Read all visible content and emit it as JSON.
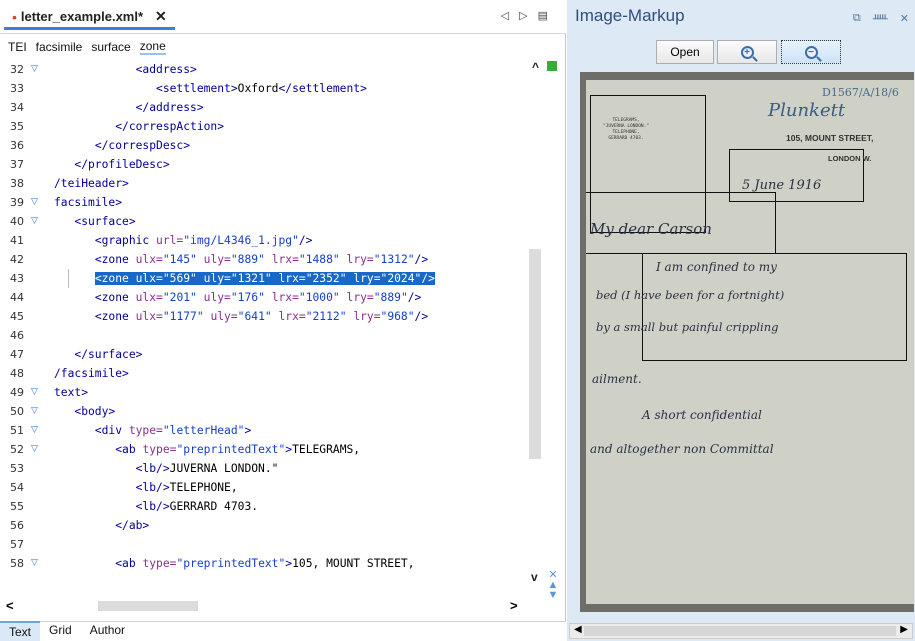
{
  "editor": {
    "tab": {
      "modified_dot": "•",
      "filename": "letter_example.xml*",
      "close": "✕"
    },
    "tab_nav": {
      "prev": "◁",
      "next": "▷",
      "menu": "▤"
    },
    "breadcrumb": [
      "TEI",
      "facsimile",
      "surface",
      "zone"
    ],
    "lines": [
      {
        "n": "32",
        "fold": "▽",
        "code": [
          [
            "",
            "            "
          ],
          [
            "tag",
            "<address>"
          ]
        ]
      },
      {
        "n": "33",
        "fold": "",
        "code": [
          [
            "",
            "               "
          ],
          [
            "tag",
            "<settlement>"
          ],
          [
            "",
            "Oxford"
          ],
          [
            "tag",
            "</settlement>"
          ]
        ]
      },
      {
        "n": "34",
        "fold": "",
        "code": [
          [
            "",
            "            "
          ],
          [
            "tag",
            "</address>"
          ]
        ]
      },
      {
        "n": "35",
        "fold": "",
        "code": [
          [
            "",
            "         "
          ],
          [
            "tag",
            "</correspAction>"
          ]
        ]
      },
      {
        "n": "36",
        "fold": "",
        "code": [
          [
            "",
            "      "
          ],
          [
            "tag",
            "</correspDesc>"
          ]
        ]
      },
      {
        "n": "37",
        "fold": "",
        "code": [
          [
            "",
            "   "
          ],
          [
            "tag",
            "</profileDesc>"
          ]
        ]
      },
      {
        "n": "38",
        "fold": "",
        "code": [
          [
            "tag",
            "/teiHeader>"
          ]
        ]
      },
      {
        "n": "39",
        "fold": "▽",
        "code": [
          [
            "tag",
            "facsimile>"
          ]
        ]
      },
      {
        "n": "40",
        "fold": "▽",
        "code": [
          [
            "",
            "   "
          ],
          [
            "tag",
            "<surface>"
          ]
        ]
      },
      {
        "n": "41",
        "fold": "",
        "code": [
          [
            "",
            "      "
          ],
          [
            "tag",
            "<graphic "
          ],
          [
            "attr",
            "url="
          ],
          [
            "val",
            "\"img/L4346_1.jpg\""
          ],
          [
            "tag",
            "/>"
          ]
        ]
      },
      {
        "n": "42",
        "fold": "",
        "code": [
          [
            "",
            "      "
          ],
          [
            "tag",
            "<zone "
          ],
          [
            "attr",
            "ulx="
          ],
          [
            "val",
            "\"145\" "
          ],
          [
            "attr",
            "uly="
          ],
          [
            "val",
            "\"889\" "
          ],
          [
            "attr",
            "lrx="
          ],
          [
            "val",
            "\"1488\" "
          ],
          [
            "attr",
            "lry="
          ],
          [
            "val",
            "\"1312\""
          ],
          [
            "tag",
            "/>"
          ]
        ]
      },
      {
        "n": "43",
        "fold": "",
        "selected": true,
        "code": [
          [
            "",
            "      "
          ],
          [
            "tag",
            "<zone "
          ],
          [
            "attr",
            "ulx="
          ],
          [
            "val",
            "\"569\" "
          ],
          [
            "attr",
            "uly="
          ],
          [
            "val",
            "\"1321\" "
          ],
          [
            "attr",
            "lrx="
          ],
          [
            "val",
            "\"2352\" "
          ],
          [
            "attr",
            "lry="
          ],
          [
            "val",
            "\"2024\""
          ],
          [
            "tag",
            "/>"
          ]
        ]
      },
      {
        "n": "44",
        "fold": "",
        "code": [
          [
            "",
            "      "
          ],
          [
            "tag",
            "<zone "
          ],
          [
            "attr",
            "ulx="
          ],
          [
            "val",
            "\"201\" "
          ],
          [
            "attr",
            "uly="
          ],
          [
            "val",
            "\"176\" "
          ],
          [
            "attr",
            "lrx="
          ],
          [
            "val",
            "\"1000\" "
          ],
          [
            "attr",
            "lry="
          ],
          [
            "val",
            "\"889\""
          ],
          [
            "tag",
            "/>"
          ]
        ]
      },
      {
        "n": "45",
        "fold": "",
        "code": [
          [
            "",
            "      "
          ],
          [
            "tag",
            "<zone "
          ],
          [
            "attr",
            "ulx="
          ],
          [
            "val",
            "\"1177\" "
          ],
          [
            "attr",
            "uly="
          ],
          [
            "val",
            "\"641\" "
          ],
          [
            "attr",
            "lrx="
          ],
          [
            "val",
            "\"2112\" "
          ],
          [
            "attr",
            "lry="
          ],
          [
            "val",
            "\"968\""
          ],
          [
            "tag",
            "/>"
          ]
        ]
      },
      {
        "n": "46",
        "fold": "",
        "code": []
      },
      {
        "n": "47",
        "fold": "",
        "code": [
          [
            "",
            "   "
          ],
          [
            "tag",
            "</surface>"
          ]
        ]
      },
      {
        "n": "48",
        "fold": "",
        "code": [
          [
            "tag",
            "/facsimile>"
          ]
        ]
      },
      {
        "n": "49",
        "fold": "▽",
        "code": [
          [
            "tag",
            "text>"
          ]
        ]
      },
      {
        "n": "50",
        "fold": "▽",
        "code": [
          [
            "",
            "   "
          ],
          [
            "tag",
            "<body>"
          ]
        ]
      },
      {
        "n": "51",
        "fold": "▽",
        "code": [
          [
            "",
            "      "
          ],
          [
            "tag",
            "<div "
          ],
          [
            "attr",
            "type="
          ],
          [
            "val",
            "\"letterHead\""
          ],
          [
            "tag",
            ">"
          ]
        ]
      },
      {
        "n": "52",
        "fold": "▽",
        "code": [
          [
            "",
            "         "
          ],
          [
            "tag",
            "<ab "
          ],
          [
            "attr",
            "type="
          ],
          [
            "val",
            "\"preprintedText\""
          ],
          [
            "tag",
            ">"
          ],
          [
            "",
            "TELEGRAMS,"
          ]
        ]
      },
      {
        "n": "53",
        "fold": "",
        "code": [
          [
            "",
            "            "
          ],
          [
            "tag",
            "<lb/>"
          ],
          [
            "",
            "JUVERNA LONDON.\""
          ]
        ]
      },
      {
        "n": "54",
        "fold": "",
        "code": [
          [
            "",
            "            "
          ],
          [
            "tag",
            "<lb/>"
          ],
          [
            "",
            "TELEPHONE,"
          ]
        ]
      },
      {
        "n": "55",
        "fold": "",
        "code": [
          [
            "",
            "            "
          ],
          [
            "tag",
            "<lb/>"
          ],
          [
            "",
            "GERRARD 4703."
          ]
        ]
      },
      {
        "n": "56",
        "fold": "",
        "code": [
          [
            "",
            "         "
          ],
          [
            "tag",
            "</ab>"
          ]
        ]
      },
      {
        "n": "57",
        "fold": "",
        "code": []
      },
      {
        "n": "58",
        "fold": "▽",
        "code": [
          [
            "",
            "         "
          ],
          [
            "tag",
            "<ab "
          ],
          [
            "attr",
            "type="
          ],
          [
            "val",
            "\"preprintedText\""
          ],
          [
            "tag",
            ">"
          ],
          [
            "",
            "105, MOUNT STREET,"
          ]
        ]
      }
    ],
    "scroll": {
      "left": "<",
      "right": ">",
      "up": "^",
      "down": "v"
    },
    "side_buttons": [
      "✕",
      "▲",
      "▼"
    ],
    "modes": [
      "Text",
      "Grid",
      "Author"
    ],
    "active_mode": "Text"
  },
  "image_markup": {
    "title": "Image-Markup",
    "controls": {
      "restore": "⧉",
      "pin": "ᚊ",
      "close": "✕"
    },
    "buttons": {
      "open": "Open",
      "zoom_in_glyph": "+",
      "zoom_out_glyph": "−"
    },
    "letter": {
      "letterhead_block": [
        "TELEGRAMS,",
        "\"JUVERNA LONDON.\"",
        "TELEPHONE,",
        "GERRARD 4703."
      ],
      "ref_number": "D1567/A/18/6",
      "signature": "Plunkett",
      "address_line1": "105, MOUNT STREET,",
      "address_line2": "LONDON W.",
      "date": "5 June 1916",
      "salutation": "My dear Carson",
      "text_lines": [
        "I am confined to my",
        "bed (I have been for a fortnight)",
        "by a small but painful crippling",
        "ailment.",
        "A short confidential",
        "and altogether non Committal"
      ]
    },
    "scroll": {
      "left": "◀",
      "right": "▶"
    }
  },
  "colors": {
    "selection": "#1868c7",
    "tag": "#00009a",
    "attr": "#8b2f8f",
    "value": "#1640c4",
    "pane_bg": "#dee9f6"
  }
}
